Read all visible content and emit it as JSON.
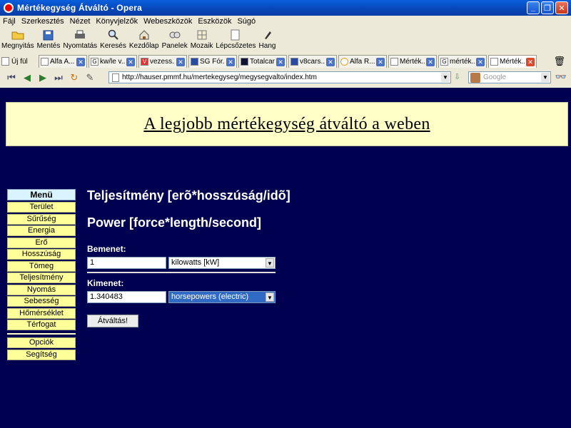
{
  "window": {
    "title": "Mértékegység Átváltó - Opera"
  },
  "menu": [
    "Fájl",
    "Szerkesztés",
    "Nézet",
    "Könyvjelzők",
    "Webeszközök",
    "Eszközök",
    "Súgó"
  ],
  "toolbar": [
    {
      "label": "Megnyitás",
      "icon": "folder-icon"
    },
    {
      "label": "Mentés",
      "icon": "save-icon"
    },
    {
      "label": "Nyomtatás",
      "icon": "print-icon"
    },
    {
      "label": "Keresés",
      "icon": "search-icon"
    },
    {
      "label": "Kezdőlap",
      "icon": "home-icon"
    },
    {
      "label": "Panelek",
      "icon": "panels-icon"
    },
    {
      "label": "Mozaik",
      "icon": "tile-icon"
    },
    {
      "label": "Lépcsőzetes",
      "icon": "cascade-icon"
    },
    {
      "label": "Hang",
      "icon": "voice-icon"
    }
  ],
  "tabs": {
    "new_tab": "Új fül",
    "items": [
      {
        "label": "Alfa A...",
        "active": false
      },
      {
        "label": "kw/le v...",
        "active": false
      },
      {
        "label": "vezess...",
        "active": false
      },
      {
        "label": "SG Fór...",
        "active": false
      },
      {
        "label": "Totalcar",
        "active": false
      },
      {
        "label": "v8cars...",
        "active": false
      },
      {
        "label": "Alfa R...",
        "active": false
      },
      {
        "label": "Mérték...",
        "active": false
      },
      {
        "label": "mérték...",
        "active": false
      },
      {
        "label": "Mérték...",
        "active": true
      }
    ]
  },
  "address": {
    "url": "http://hauser.pmmf.hu/mertekegyseg/megysegvalto/index.htm",
    "search_placeholder": "Google"
  },
  "page": {
    "banner": "A legjobb mértékegység átváltó a weben",
    "menu_title": "Menü",
    "menu_items": [
      "Terület",
      "Sűrűség",
      "Energia",
      "Erő",
      "Hosszúság",
      "Tömeg",
      "Teljesítmény",
      "Nyomás",
      "Sebesség",
      "Hőmérséklet",
      "Térfogat"
    ],
    "menu_extra": [
      "Opciók",
      "Segítség"
    ],
    "heading_hu": "Teljesítmény [erõ*hosszúság/idõ]",
    "heading_en": "Power [force*length/second]",
    "input_label": "Bemenet:",
    "input_value": "1",
    "input_unit": "kilowatts [kW]",
    "output_label": "Kimenet:",
    "output_value": "1.340483",
    "output_unit": "horsepowers (electric)",
    "convert_button": "Átváltás!"
  }
}
